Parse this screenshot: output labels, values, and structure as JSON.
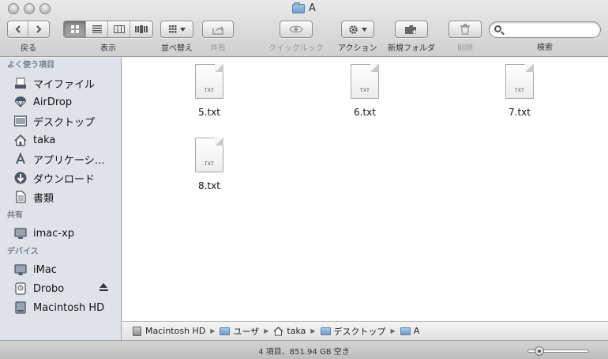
{
  "window": {
    "title": "A"
  },
  "toolbar": {
    "back_label": "戻る",
    "view_label": "表示",
    "arrange_label": "並べ替え",
    "share_label": "共有",
    "quicklook_label": "クイックルック",
    "action_label": "アクション",
    "newfolder_label": "新規フォルダ",
    "delete_label": "削除",
    "search_label": "検索",
    "search_placeholder": ""
  },
  "sidebar": {
    "sections": [
      {
        "header": "よく使う項目",
        "items": [
          {
            "label": "マイファイル",
            "icon": "allfiles-icon"
          },
          {
            "label": "AirDrop",
            "icon": "airdrop-icon"
          },
          {
            "label": "デスクトップ",
            "icon": "desktop-icon"
          },
          {
            "label": "taka",
            "icon": "home-icon"
          },
          {
            "label": "アプリケーシ…",
            "icon": "applications-icon"
          },
          {
            "label": "ダウンロード",
            "icon": "downloads-icon"
          },
          {
            "label": "書類",
            "icon": "documents-icon"
          }
        ]
      },
      {
        "header": "共有",
        "items": [
          {
            "label": "imac-xp",
            "icon": "monitor-icon"
          }
        ]
      },
      {
        "header": "デバイス",
        "items": [
          {
            "label": "iMac",
            "icon": "imac-icon"
          },
          {
            "label": "Drobo",
            "icon": "timemachine-drive-icon"
          },
          {
            "label": "Macintosh HD",
            "icon": "harddisk-icon"
          }
        ]
      }
    ]
  },
  "files": [
    {
      "name": "5.txt",
      "type": "TXT"
    },
    {
      "name": "6.txt",
      "type": "TXT"
    },
    {
      "name": "7.txt",
      "type": "TXT"
    },
    {
      "name": "8.txt",
      "type": "TXT"
    }
  ],
  "pathbar": [
    "Macintosh HD",
    "ユーザ",
    "taka",
    "デスクトップ",
    "A"
  ],
  "status": {
    "text": "4 項目、851.94 GB 空き"
  }
}
